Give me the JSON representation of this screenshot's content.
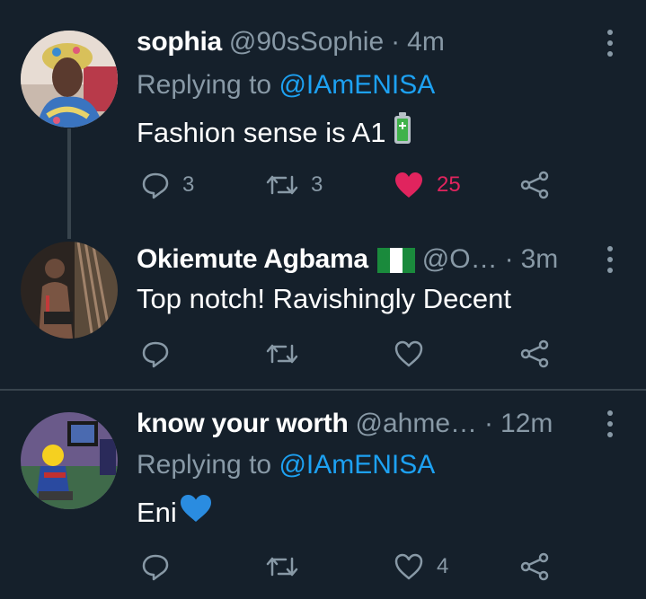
{
  "tweets": [
    {
      "name": "sophia",
      "handle": "@90sSophie",
      "time": "4m",
      "replying_prefix": "Replying to ",
      "replying_mention": "@IAmENISA",
      "text": "Fashion sense is A1",
      "emoji": "battery",
      "reply_count": "3",
      "retweet_count": "3",
      "like_count": "25",
      "liked": true
    },
    {
      "name": "Okiemute Agbama",
      "flag": "nigeria-flag",
      "handle": "@O…",
      "time": "3m",
      "text": "Top notch! Ravishingly Decent",
      "reply_count": "",
      "retweet_count": "",
      "like_count": "",
      "liked": false
    },
    {
      "name": "know your worth",
      "handle": "@ahme…",
      "time": "12m",
      "replying_prefix": "Replying to ",
      "replying_mention": "@IAmENISA",
      "text": "Eni",
      "emoji": "blue-heart",
      "reply_count": "",
      "retweet_count": "",
      "like_count": "4",
      "liked": false
    }
  ],
  "separator": "·",
  "colors": {
    "background": "#15202b",
    "muted": "#8899a6",
    "link": "#1da1f2",
    "like": "#e0245e",
    "divider": "#38444d"
  }
}
